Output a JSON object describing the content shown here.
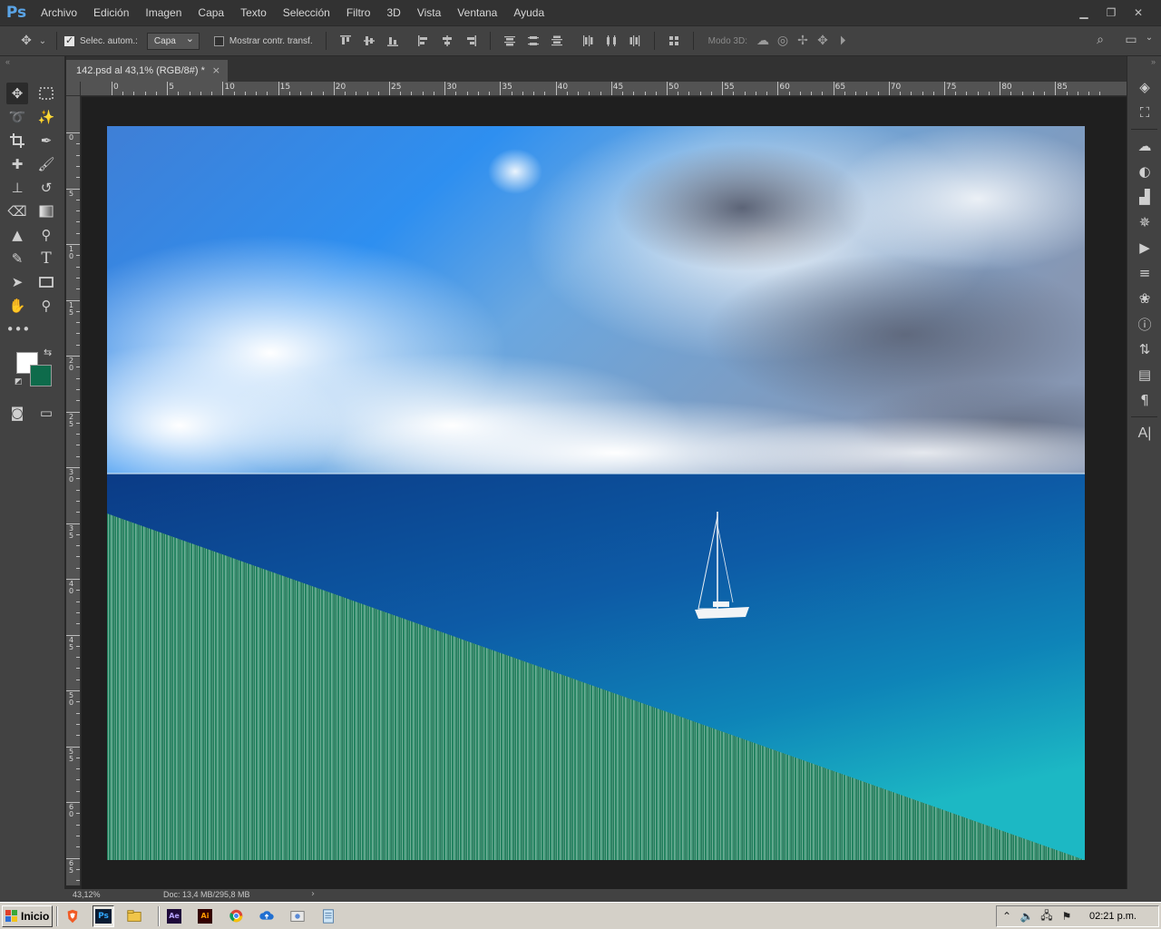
{
  "app": {
    "logo": "Ps",
    "menu": [
      "Archivo",
      "Edición",
      "Imagen",
      "Capa",
      "Texto",
      "Selección",
      "Filtro",
      "3D",
      "Vista",
      "Ventana",
      "Ayuda"
    ],
    "window_controls": [
      "minimize-icon",
      "restore-icon",
      "close-icon"
    ]
  },
  "options": {
    "auto_select_label": "Selec. autom.:",
    "auto_select_checked": true,
    "auto_select_target": "Capa",
    "transform_controls_label": "Mostrar contr. transf.",
    "transform_controls_checked": false,
    "mode3d_label": "Modo 3D:"
  },
  "document": {
    "tab_title": "142.psd al 43,1% (RGB/8#) *",
    "tab_close": "×"
  },
  "rulers": {
    "horizontal": [
      "0",
      "5",
      "10",
      "15",
      "20",
      "25",
      "30",
      "35",
      "40",
      "45",
      "50",
      "55",
      "60",
      "65",
      "70",
      "75",
      "80",
      "85"
    ],
    "vertical": [
      "0",
      "5",
      "10",
      "15",
      "20",
      "25",
      "30",
      "35",
      "40",
      "45",
      "50",
      "55",
      "60",
      "65"
    ]
  },
  "colors": {
    "foreground": "#ffffff",
    "background": "#0e6b4b",
    "accent": "#5aa4e6"
  },
  "status": {
    "zoom": "43,12%",
    "doc_info": "Doc: 13,4 MB/295,8 MB"
  },
  "taskbar": {
    "start_label": "Inicio",
    "apps": [
      {
        "name": "brave",
        "label": "B"
      },
      {
        "name": "photoshop",
        "label": "Ps"
      },
      {
        "name": "file-explorer",
        "label": ""
      },
      {
        "name": "after-effects",
        "label": "Ae"
      },
      {
        "name": "illustrator",
        "label": "Ai"
      },
      {
        "name": "chrome",
        "label": ""
      },
      {
        "name": "creative-cloud",
        "label": ""
      },
      {
        "name": "utility",
        "label": ""
      },
      {
        "name": "notepad",
        "label": ""
      }
    ],
    "clock": "02:21 p.m."
  }
}
